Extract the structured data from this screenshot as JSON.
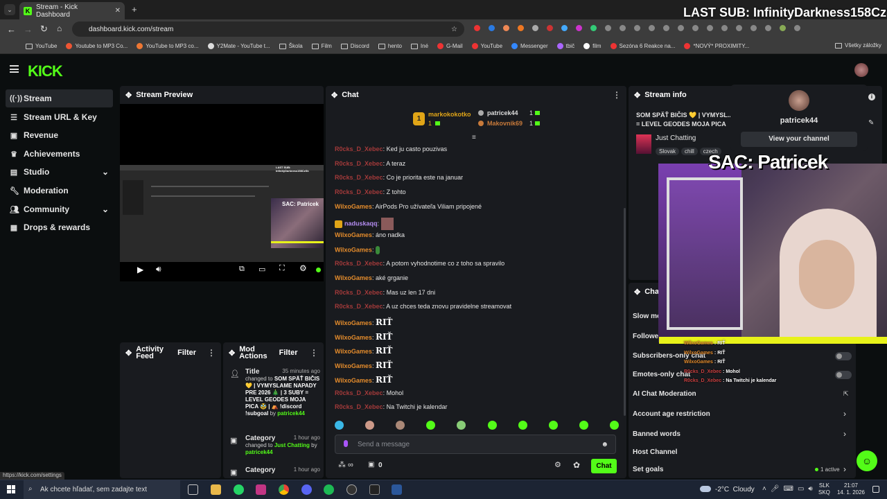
{
  "browser": {
    "tab_title": "Stream - Kick Dashboard",
    "url": "dashboard.kick.com/stream",
    "bookmarks": [
      "YouTube",
      "Youtube to MP3 Co...",
      "YouTube to MP3 co...",
      "Y2Mate - YouTube t...",
      "Škola",
      "Film",
      "Discord",
      "hento",
      "Iné",
      "G-Mail",
      "YouTube",
      "Messenger",
      "tbič",
      "film",
      "Sezóna 6 Reakce na...",
      "*NOVÝ* PROXIMITY...",
      "Všetky záložky"
    ],
    "status_url": "https://kick.com/settings"
  },
  "overlay": {
    "last_sub": "LAST SUB: InfinityDarkness158CzSk",
    "sac": "SAC: Patricek"
  },
  "sidebar": {
    "items": [
      {
        "label": "Stream",
        "icon": "stream-icon"
      },
      {
        "label": "Stream URL & Key",
        "icon": "key-icon"
      },
      {
        "label": "Revenue",
        "icon": "revenue-icon"
      },
      {
        "label": "Achievements",
        "icon": "trophy-icon"
      },
      {
        "label": "Studio",
        "icon": "studio-icon"
      },
      {
        "label": "Moderation",
        "icon": "wrench-icon"
      },
      {
        "label": "Community",
        "icon": "community-icon"
      },
      {
        "label": "Drops & rewards",
        "icon": "gift-icon"
      }
    ]
  },
  "preview": {
    "title": "Stream Preview",
    "inner_lastsub": "LAST SUB: InfinityDarkness158CzSk",
    "inner_sac": "SAC: Patricek"
  },
  "activity": {
    "title": "Activity Feed",
    "filter": "Filter"
  },
  "modactions": {
    "title": "Mod Actions",
    "filter": "Filter",
    "entries": [
      {
        "type": "Title",
        "time": "35 minutes ago",
        "changed": "changed to",
        "value": "SOM SPÄŤ BIČIS 💛 | VYMYSLAME NAPADY PRE 2026 🎄 | 3 SUBY = LEVEL GEODES MOJA PICA 🥸 | ⛺ !discord !subgoal",
        "by": "by",
        "user": "patricek44"
      },
      {
        "type": "Category",
        "time": "1 hour ago",
        "changed": "changed to",
        "value": "Just Chatting",
        "by": "by",
        "user": "patricek44"
      },
      {
        "type": "Category",
        "time": "1 hour ago"
      }
    ]
  },
  "chat": {
    "title": "Chat",
    "leaders": [
      {
        "rank": "1",
        "name": "markokokotko",
        "count": "1"
      },
      {
        "rank": "2",
        "name": "patricek44",
        "count": "1"
      },
      {
        "rank": "3",
        "name": "Makovnik69",
        "count": "1"
      }
    ],
    "messages": [
      {
        "user": "R0cks_D_Xebec",
        "text": "Ked ju casto pouzivas",
        "color": "red"
      },
      {
        "user": "R0cks_D_Xebec",
        "text": "A teraz",
        "color": "red"
      },
      {
        "user": "R0cks_D_Xebec",
        "text": "Co je priorita este na januar",
        "color": "red"
      },
      {
        "user": "R0cks_D_Xebec",
        "text": "Z tohto",
        "color": "red"
      },
      {
        "user": "WilxoGames",
        "text": "AirPods Pro užívateľa Viliam pripojené",
        "color": "orange"
      },
      {
        "user": "naduskaqq",
        "text": "",
        "color": "yellow"
      },
      {
        "user": "WilxoGames",
        "text": "áno nadka",
        "color": "orange"
      },
      {
        "user": "WilxoGames",
        "text": "",
        "color": "orange"
      },
      {
        "user": "R0cks_D_Xebec",
        "text": "A potom vyhodnotime co z toho sa spravilo",
        "color": "red"
      },
      {
        "user": "WilxoGames",
        "text": "aké grganie",
        "color": "orange"
      },
      {
        "user": "R0cks_D_Xebec",
        "text": "Mas uz len 17 dni",
        "color": "red"
      },
      {
        "user": "R0cks_D_Xebec",
        "text": "A uz chces teda znovu pravidelne streamovat",
        "color": "red"
      },
      {
        "user": "WilxoGames",
        "text": "RIŤ",
        "color": "orange"
      },
      {
        "user": "WilxoGames",
        "text": "RIŤ",
        "color": "orange"
      },
      {
        "user": "WilxoGames",
        "text": "RIŤ",
        "color": "orange"
      },
      {
        "user": "WilxoGames",
        "text": "RIŤ",
        "color": "orange"
      },
      {
        "user": "WilxoGames",
        "text": "RIŤ",
        "color": "orange"
      },
      {
        "user": "R0cks_D_Xebec",
        "text": "Mohol",
        "color": "red"
      },
      {
        "user": "R0cks_D_Xebec",
        "text": "Na Twitchi je kalendar",
        "color": "red"
      }
    ],
    "placeholder": "Send a message",
    "points": "0",
    "send": "Chat"
  },
  "streaminfo": {
    "title": "Stream info",
    "stream_title": "SOM SPÄŤ BIČIS 💛 | VYMYSL... = LEVEL GEODES MOJA PICA",
    "category": "Just Chatting",
    "tags": [
      "Slovak",
      "chill",
      "czech"
    ]
  },
  "profile": {
    "name": "patricek44",
    "view": "View your channel"
  },
  "channel": {
    "title": "Chan",
    "settings": [
      {
        "label": "Slow mo"
      },
      {
        "label": "Follower"
      },
      {
        "label": "Subscribers-only chat"
      },
      {
        "label": "Emotes-only chat"
      },
      {
        "label": "AI Chat Moderation"
      },
      {
        "label": "Account age restriction"
      },
      {
        "label": "Banned words"
      },
      {
        "label": "Host Channel"
      },
      {
        "label": "Set goals"
      }
    ],
    "active": "1 active"
  },
  "overlay_chat": [
    {
      "user": "WilxoGames",
      "text": "RIŤ"
    },
    {
      "user": "WilxoGames",
      "text": "RIŤ"
    },
    {
      "user": "WilxoGames",
      "text": "RIŤ"
    },
    {
      "user": "R0cks_D_Xebec",
      "text": "Mohol"
    },
    {
      "user": "R0cks_D_Xebec",
      "text": "Na Twitchi je kalendar"
    }
  ],
  "taskbar": {
    "search": "Ak chcete hľadať, sem zadajte text",
    "weather": "-2°C  Cloudy",
    "lang1": "SLK",
    "lang2": "SKQ",
    "time": "21:07",
    "date": "14. 1. 2026"
  },
  "colors": {
    "accent": "#53fc18",
    "red_user": "#a33a3a",
    "orange_user": "#e38b2c"
  }
}
